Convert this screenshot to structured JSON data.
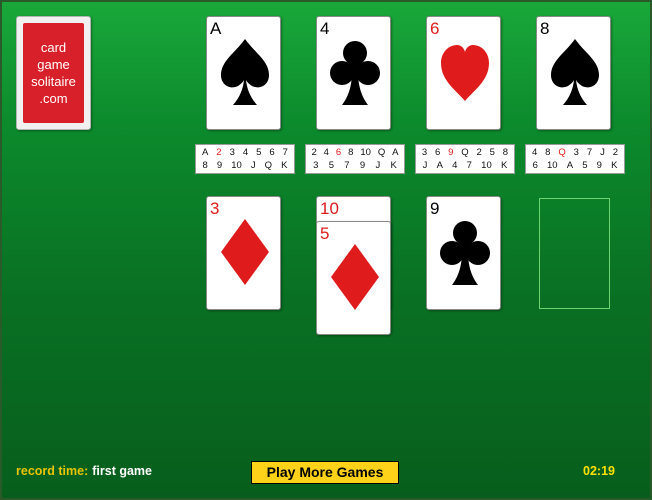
{
  "deck": {
    "lines": [
      "card",
      "game",
      "solitaire",
      ".com"
    ]
  },
  "foundations": [
    {
      "rank": "A",
      "suit": "spade",
      "color": "black"
    },
    {
      "rank": "4",
      "suit": "club",
      "color": "black"
    },
    {
      "rank": "6",
      "suit": "heart",
      "color": "red"
    },
    {
      "rank": "8",
      "suit": "spade",
      "color": "black"
    }
  ],
  "sequences": [
    {
      "row1": [
        "A",
        "2",
        "3",
        "4",
        "5",
        "6",
        "7"
      ],
      "row2": [
        "8",
        "9",
        "10",
        "J",
        "Q",
        "K"
      ],
      "highlight_row1": 1
    },
    {
      "row1": [
        "2",
        "4",
        "6",
        "8",
        "10",
        "Q",
        "A"
      ],
      "row2": [
        "3",
        "5",
        "7",
        "9",
        "J",
        "K"
      ],
      "highlight_row1": 2
    },
    {
      "row1": [
        "3",
        "6",
        "9",
        "Q",
        "2",
        "5",
        "8"
      ],
      "row2": [
        "J",
        "A",
        "4",
        "7",
        "10",
        "K"
      ],
      "highlight_row1": 2
    },
    {
      "row1": [
        "4",
        "8",
        "Q",
        "3",
        "7",
        "J",
        "2"
      ],
      "row2": [
        "6",
        "10",
        "A",
        "5",
        "9",
        "K"
      ],
      "highlight_row1": 2
    }
  ],
  "tableau": [
    [
      {
        "rank": "3",
        "suit": "diamond",
        "color": "red"
      }
    ],
    [
      {
        "rank": "10",
        "suit": "diamond",
        "color": "red"
      },
      {
        "rank": "5",
        "suit": "diamond",
        "color": "red"
      }
    ],
    [
      {
        "rank": "9",
        "suit": "club",
        "color": "black"
      }
    ],
    []
  ],
  "footer": {
    "record_label": "record time:",
    "record_value": "first game",
    "play_more_label": "Play More Games",
    "timer": "02:19"
  },
  "colors": {
    "red": "#e01b1b",
    "button": "#ffd21a",
    "record_label": "#e8c400",
    "timer": "#ffe000"
  }
}
